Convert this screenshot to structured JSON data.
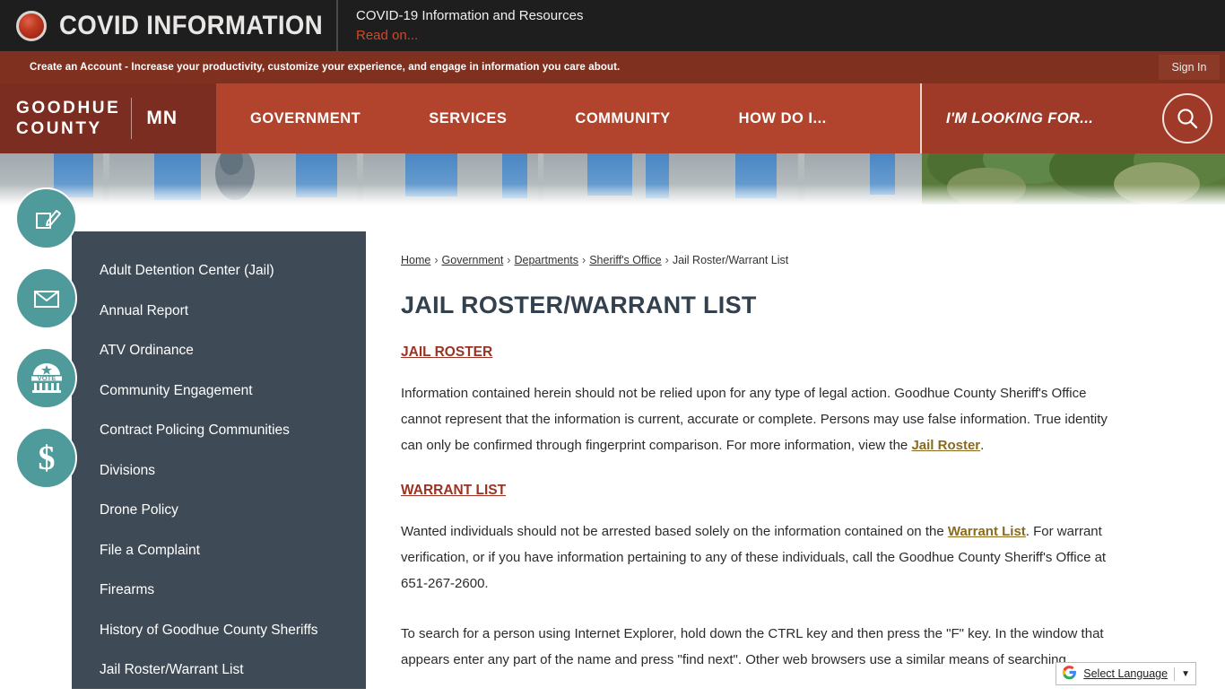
{
  "alert": {
    "icon": "red-orb-icon",
    "title": "COVID INFORMATION",
    "subtitle": "COVID-19 Information and Resources",
    "read_on": "Read on..."
  },
  "account_bar": {
    "message": "Create an Account - Increase your productivity, customize your experience, and engage in information you care about.",
    "sign_in": "Sign In"
  },
  "nav": {
    "logo_line1": "GOODHUE",
    "logo_line2": "COUNTY",
    "state": "MN",
    "links": [
      {
        "label": "GOVERNMENT"
      },
      {
        "label": "SERVICES"
      },
      {
        "label": "COMMUNITY"
      },
      {
        "label": "HOW DO I..."
      }
    ],
    "looking_for": "I'M LOOKING FOR...",
    "search_icon": "search-icon"
  },
  "rail_icons": [
    {
      "name": "notify-me-icon"
    },
    {
      "name": "email-icon"
    },
    {
      "name": "vote-icon"
    },
    {
      "name": "pay-dollar-icon"
    }
  ],
  "sidebar": {
    "items": [
      {
        "label": "Adult Detention Center (Jail)"
      },
      {
        "label": "Annual Report"
      },
      {
        "label": "ATV Ordinance"
      },
      {
        "label": "Community Engagement"
      },
      {
        "label": "Contract Policing Communities"
      },
      {
        "label": "Divisions"
      },
      {
        "label": "Drone Policy"
      },
      {
        "label": "File a Complaint"
      },
      {
        "label": "Firearms"
      },
      {
        "label": "History of Goodhue County Sheriffs"
      },
      {
        "label": "Jail Roster/Warrant List"
      }
    ]
  },
  "breadcrumb": {
    "items": [
      {
        "label": "Home",
        "link": true
      },
      {
        "label": "Government",
        "link": true
      },
      {
        "label": "Departments",
        "link": true
      },
      {
        "label": "Sheriff's Office",
        "link": true
      },
      {
        "label": "Jail Roster/Warrant List",
        "link": false
      }
    ],
    "separator": "›"
  },
  "main": {
    "title": "JAIL ROSTER/WARRANT LIST",
    "section1_heading": "JAIL ROSTER",
    "section1_text_a": "Information contained herein should not be relied upon for any type of legal action. Goodhue County Sheriff's Office cannot represent that the information is current, accurate or complete. Persons may use false information. True identity can only be confirmed through fingerprint comparison. For more information, view the ",
    "section1_link": "Jail Roster",
    "section1_text_b": ".",
    "section2_heading": "WARRANT LIST",
    "section2_text_a": "Wanted individuals should not be arrested based solely on the information contained on the ",
    "section2_link": "Warrant List",
    "section2_text_b": ". For warrant verification, or if you have information pertaining to any of these individuals, call the Goodhue County Sheriff's Office at 651-267-2600.",
    "section3_text": "To search for a person using Internet Explorer, hold down the CTRL key and then press the \"F\" key. In the window that appears enter any part of the name and press \"find next\". Other web browsers use a similar means of searching."
  },
  "translate": {
    "logo": "G",
    "label": "Select Language",
    "caret": "▼"
  },
  "colors": {
    "alert_bg": "#1e1e1e",
    "account_bg": "#80301f",
    "nav_bg": "#b2432c",
    "nav_logo_bg": "#7a2d20",
    "nav_right_bg": "#9e3a27",
    "sidebar_bg": "#3e4a56",
    "rail_icon_bg": "#4f9a9a",
    "heading_red": "#9a3324",
    "link_gold": "#8a6a1e",
    "title_slate": "#33414e",
    "read_on_red": "#cf4a28"
  }
}
